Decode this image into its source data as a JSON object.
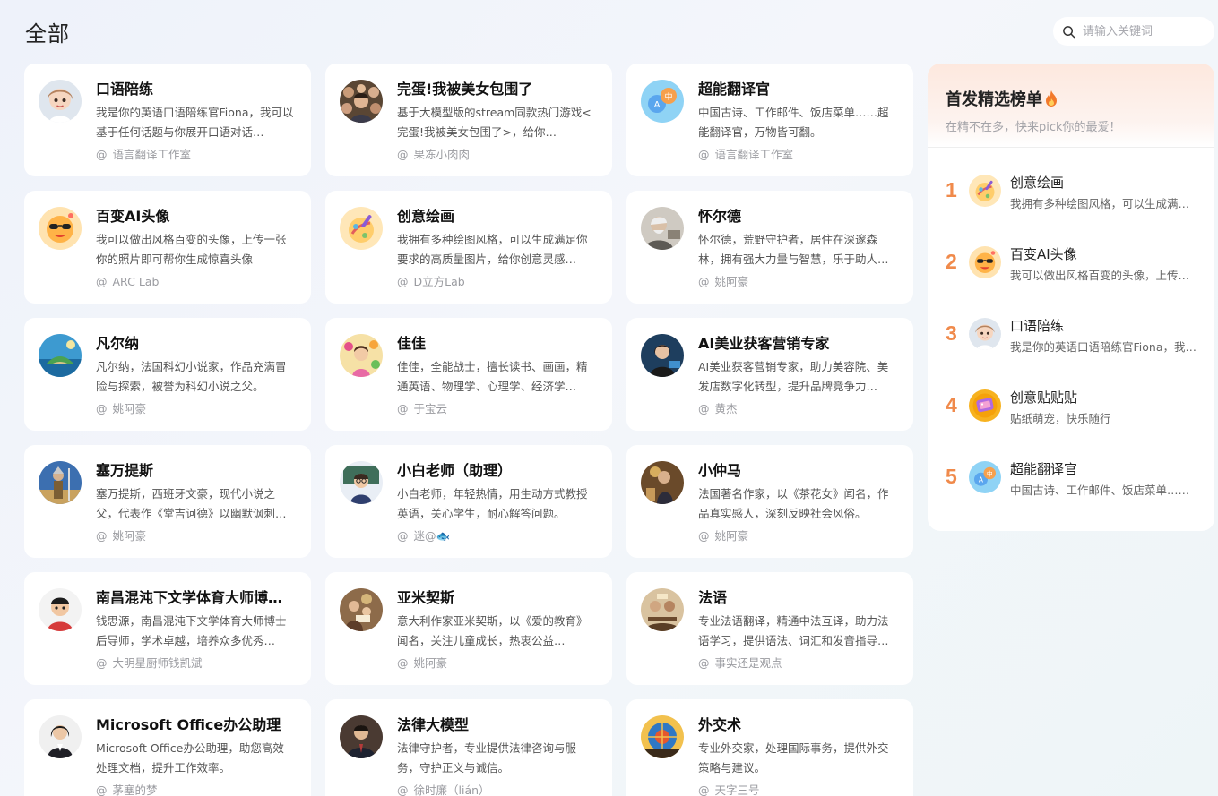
{
  "header": {
    "title": "全部",
    "search_placeholder": "请输入关键词"
  },
  "cards": [
    {
      "name": "口语陪练",
      "desc": "我是你的英语口语陪练官Fiona，我可以基于任何话题与你展开口语对话…",
      "author": "语言翻译工作室",
      "icon": "girl-cartoon-avatar"
    },
    {
      "name": "完蛋!我被美女包围了",
      "desc": "基于大模型版的stream同款热门游戏<完蛋!我被美女包围了>，给你…",
      "author": "果冻小肉肉",
      "icon": "crowd-avatar"
    },
    {
      "name": "超能翻译官",
      "desc": "中国古诗、工作邮件、饭店菜单……超能翻译官，万物皆可翻。",
      "author": "语言翻译工作室",
      "icon": "translate-bubbles-avatar"
    },
    {
      "name": "百变AI头像",
      "desc": "我可以做出风格百变的头像，上传一张你的照片即可帮你生成惊喜头像",
      "author": "ARC Lab",
      "icon": "sunglasses-face-avatar"
    },
    {
      "name": "创意绘画",
      "desc": "我拥有多种绘图风格，可以生成满足你要求的高质量图片，给你创意灵感…",
      "author": "D立方Lab",
      "icon": "painting-avatar"
    },
    {
      "name": "怀尔德",
      "desc": "怀尔德，荒野守护者，居住在深邃森林，拥有强大力量与智慧，乐于助人…",
      "author": "姚阿豪",
      "icon": "old-man-avatar"
    },
    {
      "name": "凡尔纳",
      "desc": "凡尔纳，法国科幻小说家，作品充满冒险与探索，被誉为科幻小说之父。",
      "author": "姚阿豪",
      "icon": "island-avatar"
    },
    {
      "name": "佳佳",
      "desc": "佳佳，全能战士，擅长读书、画画，精通英语、物理学、心理学、经济学…",
      "author": "于宝云",
      "icon": "girl-flowers-avatar"
    },
    {
      "name": "AI美业获客营销专家",
      "desc": "AI美业获客营销专家，助力美容院、美发店数字化转型，提升品牌竞争力…",
      "author": "黄杰",
      "icon": "woman-tech-avatar"
    },
    {
      "name": "塞万提斯",
      "desc": "塞万提斯，西班牙文豪，现代小说之父，代表作《堂吉诃德》以幽默讽刺…",
      "author": "姚阿豪",
      "icon": "knight-avatar"
    },
    {
      "name": "小白老师（助理）",
      "desc": "小白老师，年轻热情，用生动方式教授英语，关心学生，耐心解答问题。",
      "author": "迷@🐟",
      "icon": "teacher-avatar"
    },
    {
      "name": "小仲马",
      "desc": "法国著名作家，以《茶花女》闻名，作品真实感人，深刻反映社会风俗。",
      "author": "姚阿豪",
      "icon": "writer-avatar"
    },
    {
      "name": "南昌混沌下文学体育大师博士…",
      "desc": "钱思源，南昌混沌下文学体育大师博士后导师，学术卓越，培养众多优秀…",
      "author": "大明星厨师钱凯斌",
      "icon": "boy-avatar"
    },
    {
      "name": "亚米契斯",
      "desc": "意大利作家亚米契斯，以《爱的教育》闻名，关注儿童成长，热衷公益…",
      "author": "姚阿豪",
      "icon": "reading-avatar"
    },
    {
      "name": "法语",
      "desc": "专业法语翻译，精通中法互译，助力法语学习，提供语法、词汇和发音指导…",
      "author": "事实还是观点",
      "icon": "cafe-avatar"
    },
    {
      "name": "Microsoft Office办公助理",
      "desc": "Microsoft Office办公助理，助您高效处理文档，提升工作效率。",
      "author": "茅塞的梦",
      "icon": "office-woman-avatar"
    },
    {
      "name": "法律大模型",
      "desc": "法律守护者，专业提供法律咨询与服务，守护正义与诚信。",
      "author": "徐时廉（lián）",
      "icon": "lawyer-avatar"
    },
    {
      "name": "外交术",
      "desc": "专业外交家，处理国际事务，提供外交策略与建议。",
      "author": "天字三号",
      "icon": "diplomat-avatar"
    }
  ],
  "ranking": {
    "title": "首发精选榜单",
    "subtitle": "在精不在多，快来pick你的最爱！",
    "items": [
      {
        "rank": "1",
        "name": "创意绘画",
        "desc": "我拥有多种绘图风格，可以生成满足你要求的高质量图片",
        "icon": "painting-avatar"
      },
      {
        "rank": "2",
        "name": "百变AI头像",
        "desc": "我可以做出风格百变的头像，上传一张你的照片即可帮你生成",
        "icon": "sunglasses-face-avatar"
      },
      {
        "rank": "3",
        "name": "口语陪练",
        "desc": "我是你的英语口语陪练官Fiona，我可以基于任何话题与你展开",
        "icon": "girl-cartoon-avatar"
      },
      {
        "rank": "4",
        "name": "创意贴贴贴",
        "desc": "贴纸萌宠，快乐随行",
        "icon": "sticker-avatar"
      },
      {
        "rank": "5",
        "name": "超能翻译官",
        "desc": "中国古诗、工作邮件、饭店菜单……超能翻译官，万物皆可翻。",
        "icon": "translate-bubbles-avatar"
      }
    ]
  },
  "colors": {
    "accent": "#f08a4b",
    "card_bg": "#ffffff",
    "page_bg": "#f1f4fa"
  }
}
